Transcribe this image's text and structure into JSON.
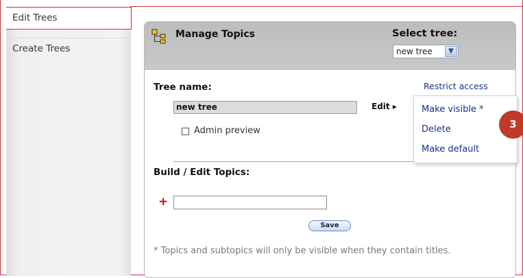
{
  "sidebar": {
    "items": [
      {
        "label": "Edit Trees"
      },
      {
        "label": "Create Trees"
      }
    ]
  },
  "panel": {
    "title": "Manage Topics",
    "select_tree_label": "Select tree:",
    "select_tree_value": "new tree",
    "tree_name_label": "Tree name:",
    "restrict_access": "Restrict access",
    "tree_name_value": "new tree",
    "edit_label": "Edit ▸",
    "admin_preview_label": "Admin preview",
    "build_label": "Build / Edit Topics:",
    "plus_symbol": "+",
    "save_label": "Save",
    "note": "* Topics and subtopics will only be visible when they contain titles."
  },
  "edit_menu": {
    "items": [
      "Make visible *",
      "Delete",
      "Make default"
    ]
  },
  "step_badge": "3",
  "colors": {
    "accent_red": "#c9303a",
    "link_blue": "#1a2f8a",
    "badge_red": "#c0392b",
    "header_gray": "#c2c2c2"
  },
  "icons": {
    "tree": "tree-structure-icon",
    "dropdown": "chevron-down-icon"
  }
}
